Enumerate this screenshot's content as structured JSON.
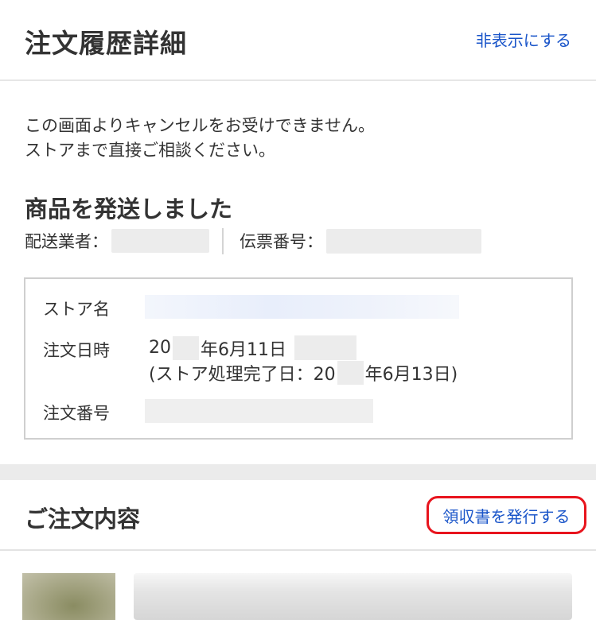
{
  "header": {
    "title": "注文履歴詳細",
    "hide_link": "非表示にする"
  },
  "notice": {
    "line1": "この画面よりキャンセルをお受けできません。",
    "line2": "ストアまで直接ご相談ください。"
  },
  "shipping": {
    "status_title": "商品を発送しました",
    "carrier_label": "配送業者：",
    "slip_label": "伝票番号："
  },
  "order_info": {
    "store_label": "ストア名",
    "date_label": "注文日時",
    "order_number_label": "注文番号",
    "date_prefix": "20",
    "date_suffix": "年6月11日",
    "processed_prefix": "(ストア処理完了日：20",
    "processed_suffix": "年6月13日)"
  },
  "contents": {
    "title": "ご注文内容",
    "receipt_button": "領収書を発行する"
  },
  "colors": {
    "link": "#1a55c9",
    "highlight_border": "#e8141d",
    "band": "#ebebeb"
  }
}
